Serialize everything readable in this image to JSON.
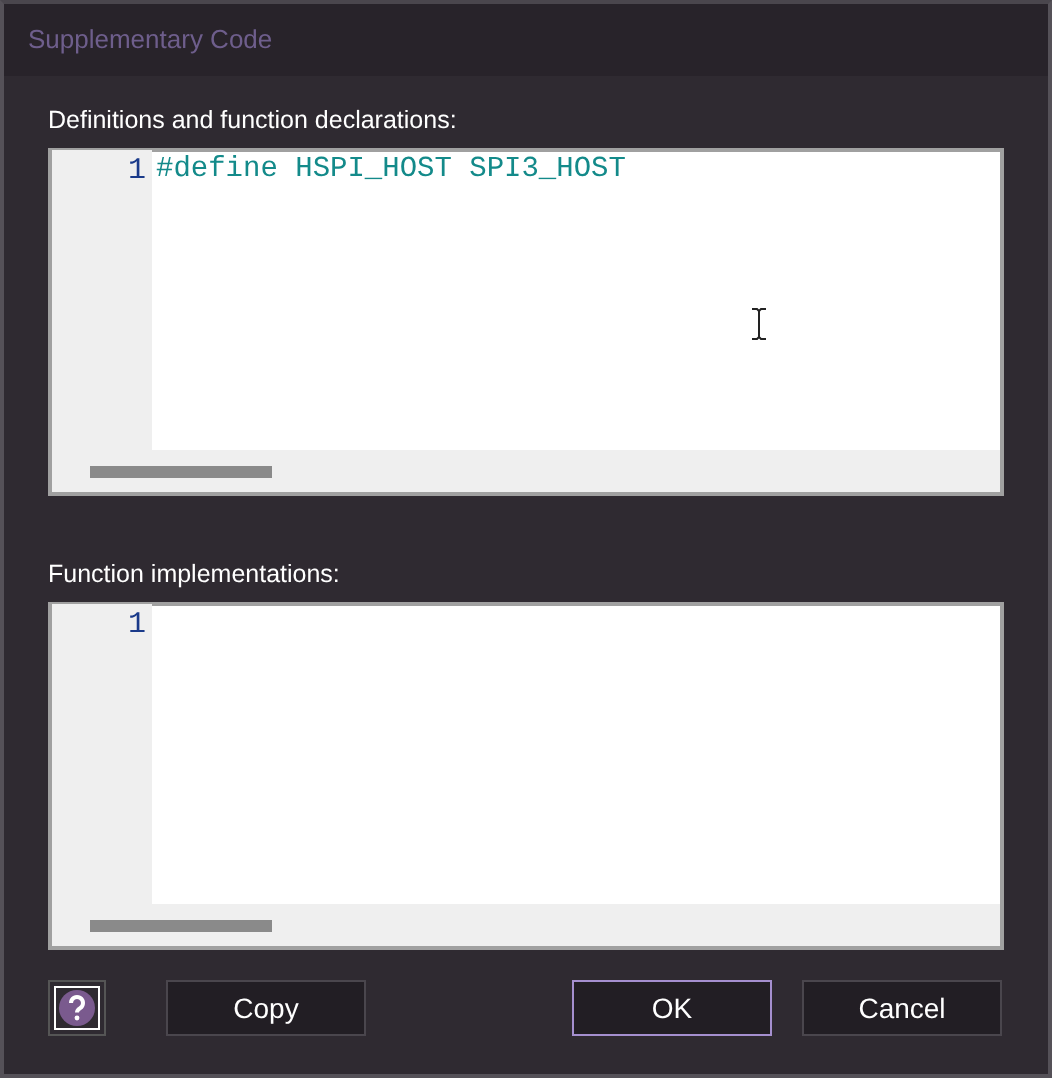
{
  "window": {
    "title": "Supplementary Code"
  },
  "editors": [
    {
      "label": "Definitions and function declarations:",
      "lines": [
        {
          "number": "1",
          "code": "#define HSPI_HOST SPI3_HOST"
        }
      ],
      "text_cursor": true
    },
    {
      "label": "Function implementations:",
      "lines": [
        {
          "number": "1"
        }
      ]
    }
  ],
  "buttons": [
    {
      "kind": "help",
      "focused": false
    },
    {
      "kind": "text",
      "label": "Copy",
      "focused": false
    },
    {
      "kind": "text",
      "label": "OK",
      "focused": true
    },
    {
      "kind": "text",
      "label": "Cancel",
      "focused": false
    }
  ]
}
